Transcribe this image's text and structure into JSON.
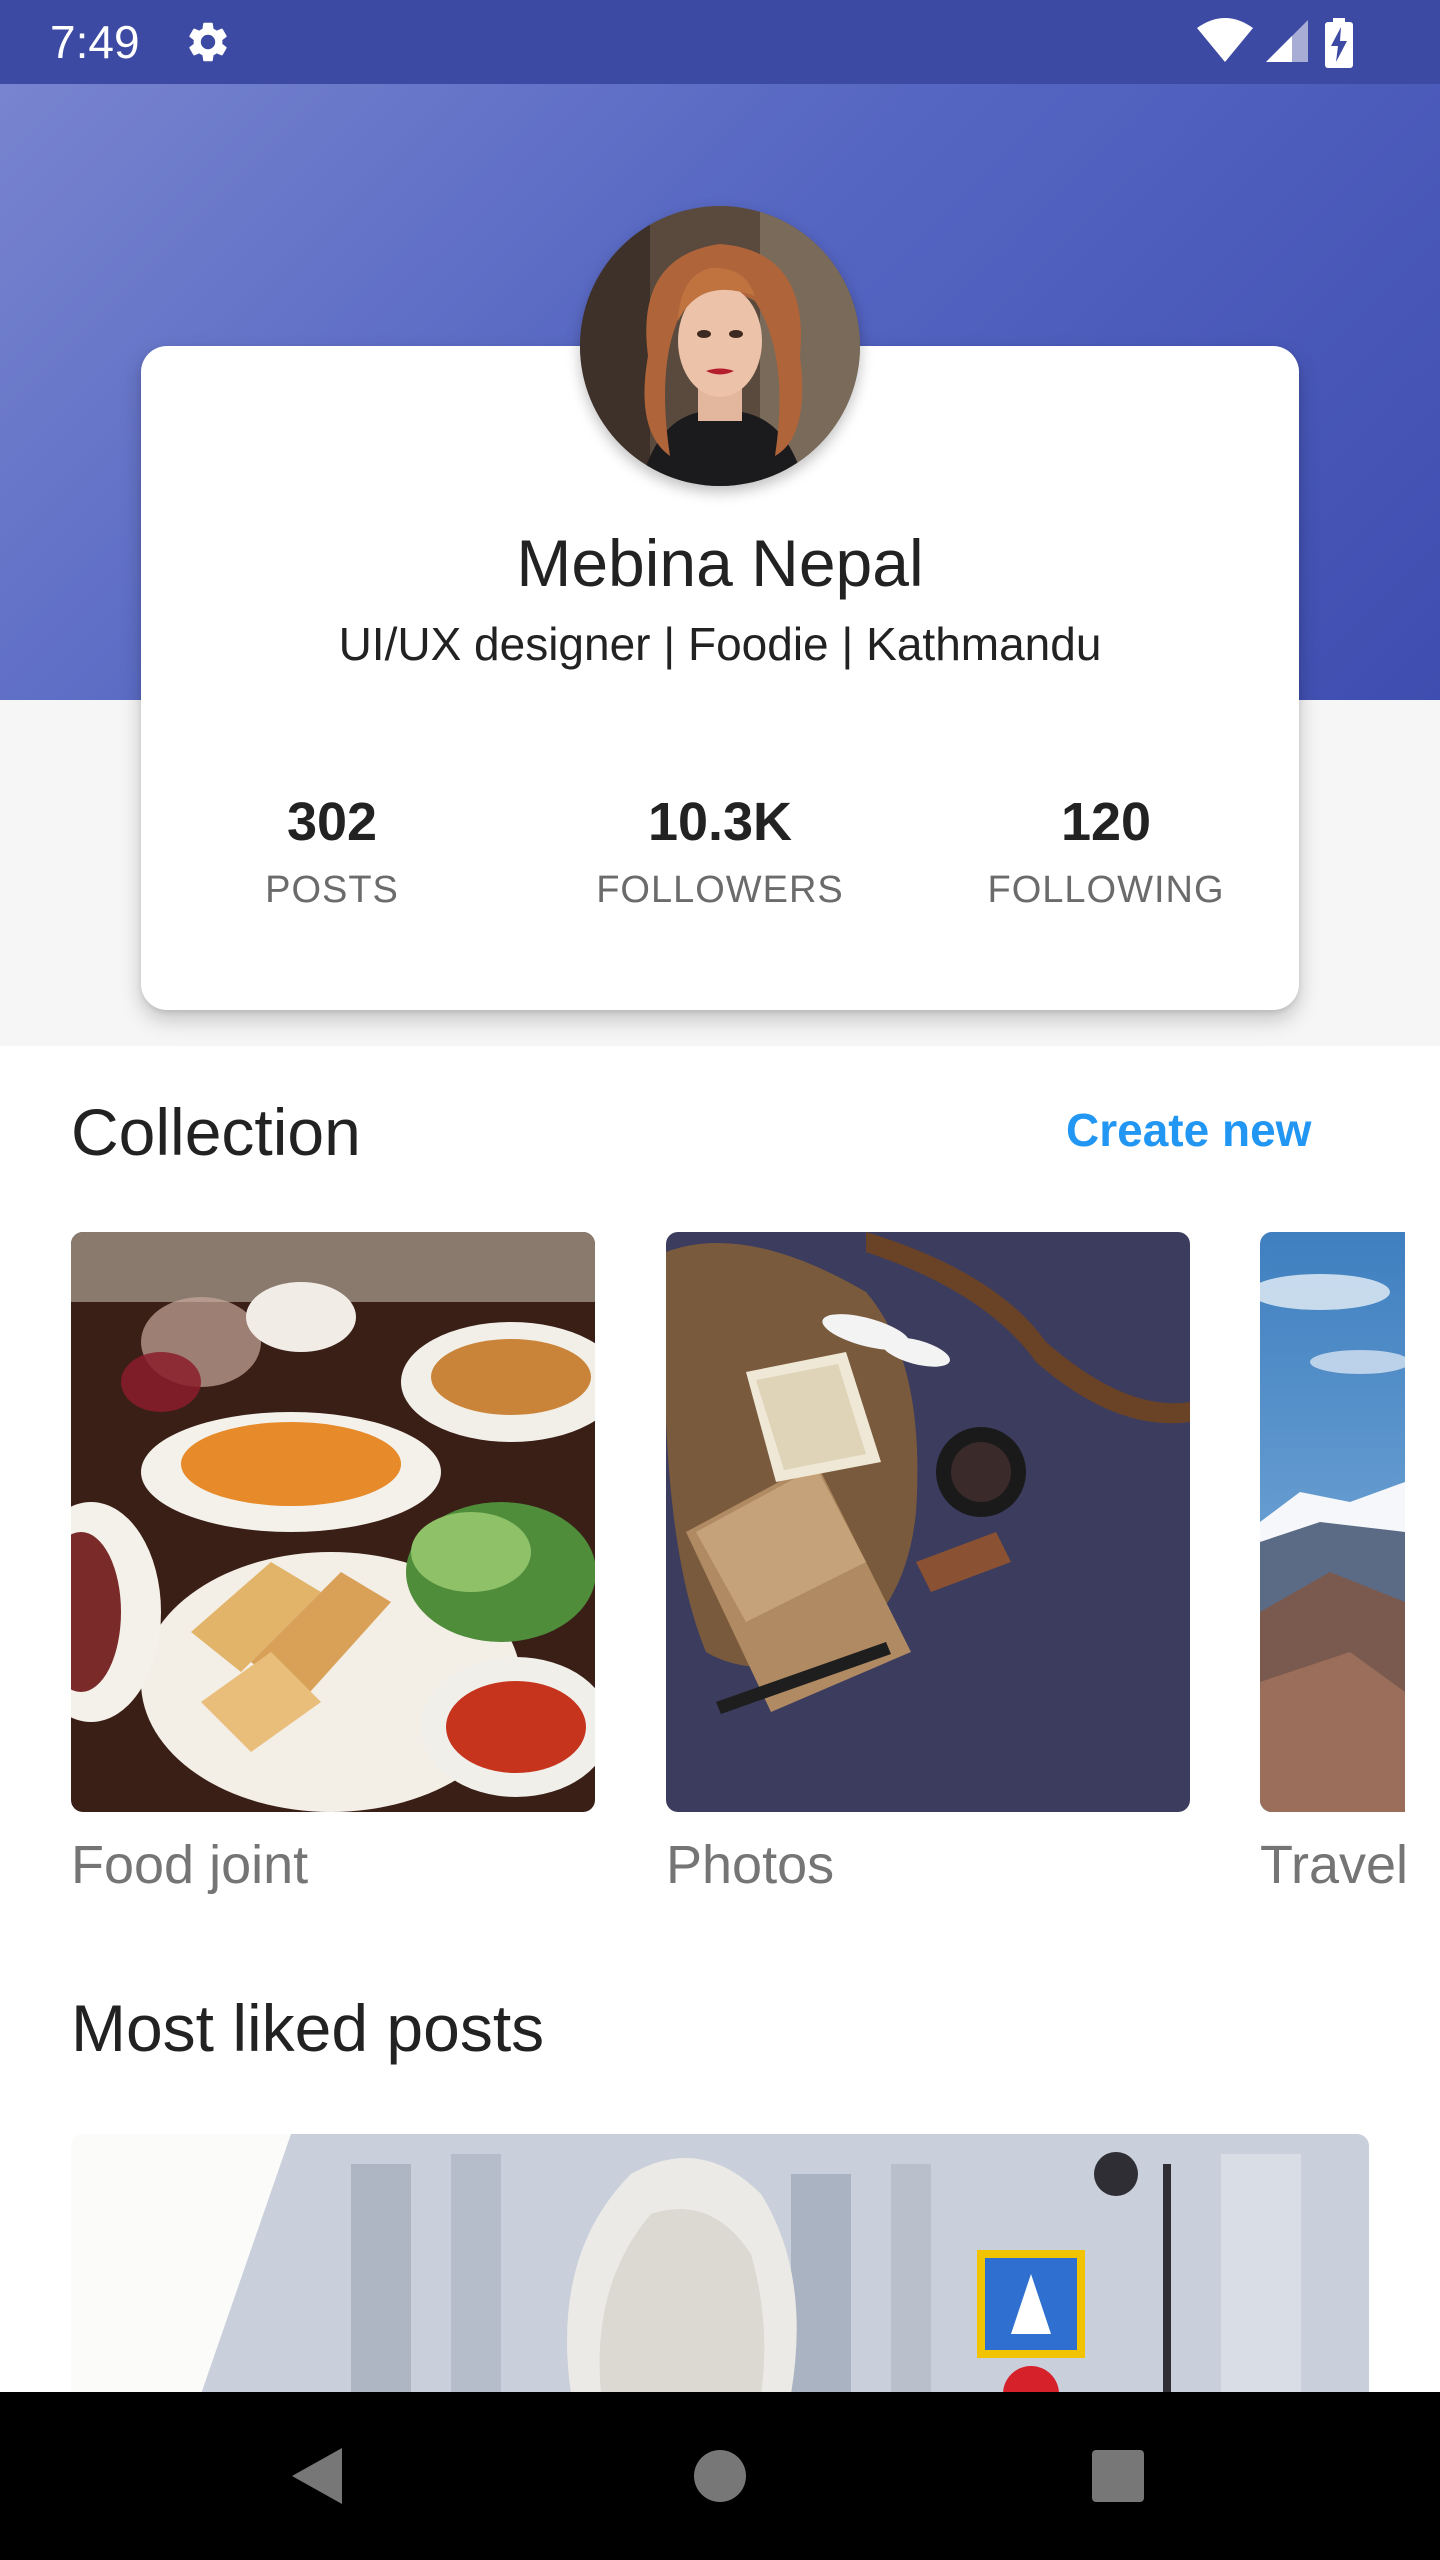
{
  "status_bar": {
    "time": "7:49"
  },
  "profile": {
    "name": "Mebina Nepal",
    "bio": "UI/UX designer | Foodie | Kathmandu",
    "stats": [
      {
        "value": "302",
        "label": "POSTS"
      },
      {
        "value": "10.3K",
        "label": "FOLLOWERS"
      },
      {
        "value": "120",
        "label": "FOLLOWING"
      }
    ]
  },
  "collection": {
    "title": "Collection",
    "action": "Create new",
    "items": [
      {
        "label": "Food joint"
      },
      {
        "label": "Photos"
      },
      {
        "label": "Travel"
      }
    ]
  },
  "most_liked": {
    "title": "Most liked posts"
  },
  "colors": {
    "status_bar": "#3d4aa3",
    "header_gradient_start": "#7884cf",
    "header_gradient_end": "#3f4db0",
    "accent_link": "#2196f3",
    "muted_text": "#757575"
  },
  "icons": {
    "status_bar": [
      "settings-gear-icon",
      "wifi-icon",
      "cell-signal-icon",
      "battery-charging-icon"
    ],
    "nav_bar": [
      "back-triangle-icon",
      "home-circle-icon",
      "recents-square-icon"
    ]
  }
}
